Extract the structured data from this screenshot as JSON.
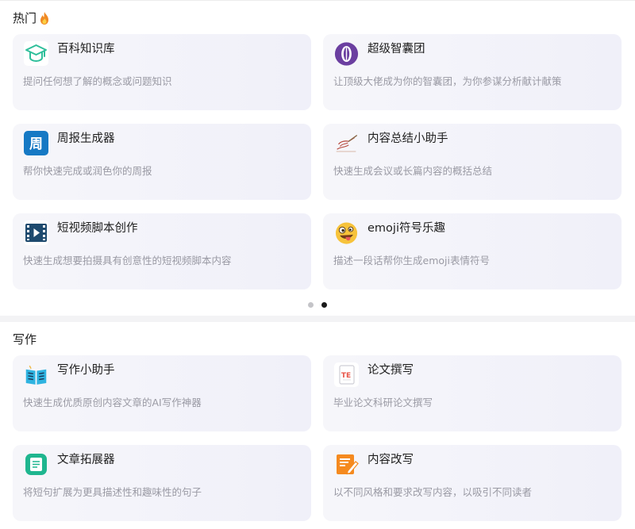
{
  "hot": {
    "title": "热门",
    "fire_icon": "fire-icon",
    "cards": [
      {
        "title": "百科知识库",
        "desc": "提问任何想了解的概念或问题知识",
        "icon": "graduation-cap-icon"
      },
      {
        "title": "超级智囊团",
        "desc": "让顶级大佬成为你的智囊团，为你参谋分析献计献策",
        "icon": "think-tank-icon"
      },
      {
        "title": "周报生成器",
        "desc": "帮你快速完成或润色你的周报",
        "icon": "weekly-report-icon"
      },
      {
        "title": "内容总结小助手",
        "desc": "快速生成会议或长篇内容的概括总结",
        "icon": "writing-hand-icon"
      },
      {
        "title": "短视频脚本创作",
        "desc": "快速生成想要拍摄具有创意性的短视频脚本内容",
        "icon": "film-strip-icon"
      },
      {
        "title": "emoji符号乐趣",
        "desc": "描述一段话帮你生成emoji表情符号",
        "icon": "silly-face-emoji-icon"
      }
    ],
    "pagination": {
      "total": 2,
      "active": 2
    }
  },
  "writing": {
    "title": "写作",
    "cards": [
      {
        "title": "写作小助手",
        "desc": "快速生成优质原创内容文章的AI写作神器",
        "icon": "open-book-icon"
      },
      {
        "title": "论文撰写",
        "desc": "毕业论文科研论文撰写",
        "icon": "thesis-document-icon"
      },
      {
        "title": "文章拓展器",
        "desc": "将短句扩展为更具描述性和趣味性的句子",
        "icon": "article-expand-icon"
      },
      {
        "title": "内容改写",
        "desc": "以不同风格和要求改写内容，以吸引不同读者",
        "icon": "edit-pencil-icon"
      }
    ]
  },
  "colors": {
    "card_bg": "#f3f3f9",
    "desc_text": "#9a9aa4",
    "dot_active": "#1a1a1a",
    "dot_inactive": "#c4c4c8"
  }
}
